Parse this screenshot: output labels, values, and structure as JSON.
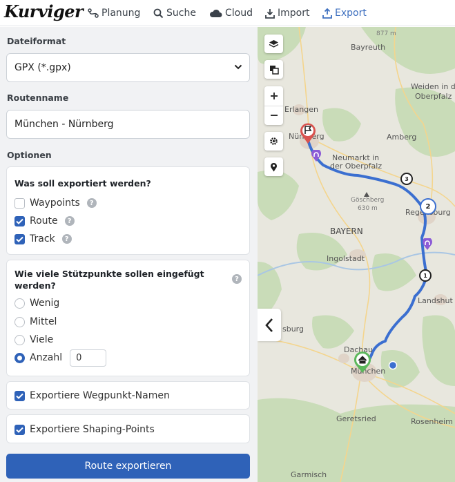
{
  "app": {
    "logo": "Kurviger"
  },
  "nav": {
    "planning": "Planung",
    "search": "Suche",
    "cloud": "Cloud",
    "import": "Import",
    "export": "Export"
  },
  "form": {
    "file_format_label": "Dateiformat",
    "file_format_value": "GPX (*.gpx)",
    "route_name_label": "Routenname",
    "route_name_value": "München - Nürnberg",
    "options_label": "Optionen",
    "export_what": {
      "title": "Was soll exportiert werden?",
      "items": [
        {
          "label": "Waypoints",
          "checked": false
        },
        {
          "label": "Route",
          "checked": true
        },
        {
          "label": "Track",
          "checked": true
        }
      ]
    },
    "points": {
      "title": "Wie viele Stützpunkte sollen eingefügt werden?",
      "options": [
        {
          "label": "Wenig",
          "selected": false
        },
        {
          "label": "Mittel",
          "selected": false
        },
        {
          "label": "Viele",
          "selected": false
        },
        {
          "label": "Anzahl",
          "selected": true
        }
      ],
      "count_value": "0"
    },
    "export_waypoint_names": {
      "label": "Exportiere Wegpunkt-Namen",
      "checked": true
    },
    "export_shaping_points": {
      "label": "Exportiere Shaping-Points",
      "checked": true
    },
    "submit_label": "Route exportieren"
  },
  "map": {
    "places": {
      "bayreuth": "Bayreuth",
      "erlangen": "Erlangen",
      "nuernberg": "Nürnberg",
      "amberg": "Amberg",
      "weiden1": "Weiden in der",
      "weiden2": "Oberpfalz",
      "neumarkt1": "Neumarkt in",
      "neumarkt2": "der Oberpfalz",
      "goeschberg": "Göschberg",
      "goeschberg_height": "630 m",
      "bayern": "BAYERN",
      "regensburg": "Regensburg",
      "ingolstadt": "Ingolstadt",
      "landshut": "Landshut",
      "augsburg": "sburg",
      "dachau": "Dachau",
      "muenchen": "München",
      "geretsried": "Geretsried",
      "rosenheim": "Rosenheim",
      "garmisch": "Garmisch",
      "peak_height": "877 m"
    },
    "markers": [
      "3",
      "2",
      "1"
    ],
    "colors": {
      "route": "#3b6fd0",
      "accent": "#2f62b8",
      "start": "#5cb85c",
      "end": "#d9534f",
      "shaping": "#8c5bd6"
    }
  }
}
